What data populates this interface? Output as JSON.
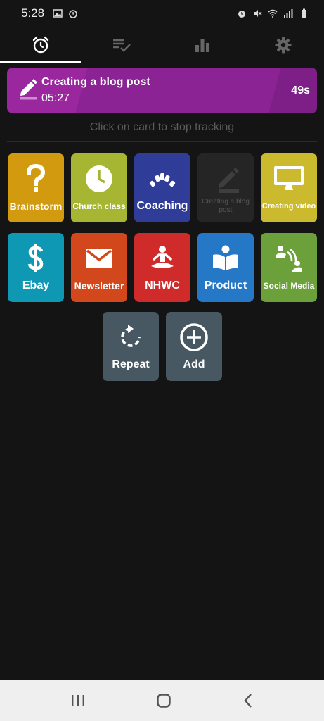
{
  "status_bar": {
    "time": "5:28"
  },
  "tabs": [
    {
      "name": "timer",
      "icon": "alarm-clock-icon",
      "active": true
    },
    {
      "name": "tasks",
      "icon": "playlist-check-icon",
      "active": false
    },
    {
      "name": "stats",
      "icon": "bar-chart-icon",
      "active": false
    },
    {
      "name": "settings",
      "icon": "gear-icon",
      "active": false
    }
  ],
  "active_task": {
    "title": "Creating a blog post",
    "elapsed": "05:27",
    "seconds": "49s",
    "color": "#8b2395"
  },
  "hint": "Click on card to stop tracking",
  "cards": [
    {
      "label": "Brainstorm",
      "icon": "question-mark-icon",
      "color": "#d29a0f"
    },
    {
      "label": "Church class",
      "icon": "clock-icon",
      "color": "#a6b632"
    },
    {
      "label": "Coaching",
      "icon": "gauge-icon",
      "color": "#2f3d99"
    },
    {
      "label": "Creating a blog post",
      "icon": "pencil-icon",
      "color": "#252525",
      "disabled": true
    },
    {
      "label": "Creating video",
      "icon": "monitor-icon",
      "color": "#cbba2d"
    },
    {
      "label": "Ebay",
      "icon": "dollar-icon",
      "color": "#0e98b3"
    },
    {
      "label": "Newsletter",
      "icon": "envelope-icon",
      "color": "#d2481c"
    },
    {
      "label": "NHWC",
      "icon": "meditation-icon",
      "color": "#cf2b2b"
    },
    {
      "label": "Product",
      "icon": "reading-icon",
      "color": "#2478c6"
    },
    {
      "label": "Social Media",
      "icon": "people-talk-icon",
      "color": "#6ba03a"
    },
    {
      "label": "Repeat",
      "icon": "repeat-icon",
      "color": "#475862"
    },
    {
      "label": "Add",
      "icon": "add-circle-icon",
      "color": "#475862"
    }
  ]
}
